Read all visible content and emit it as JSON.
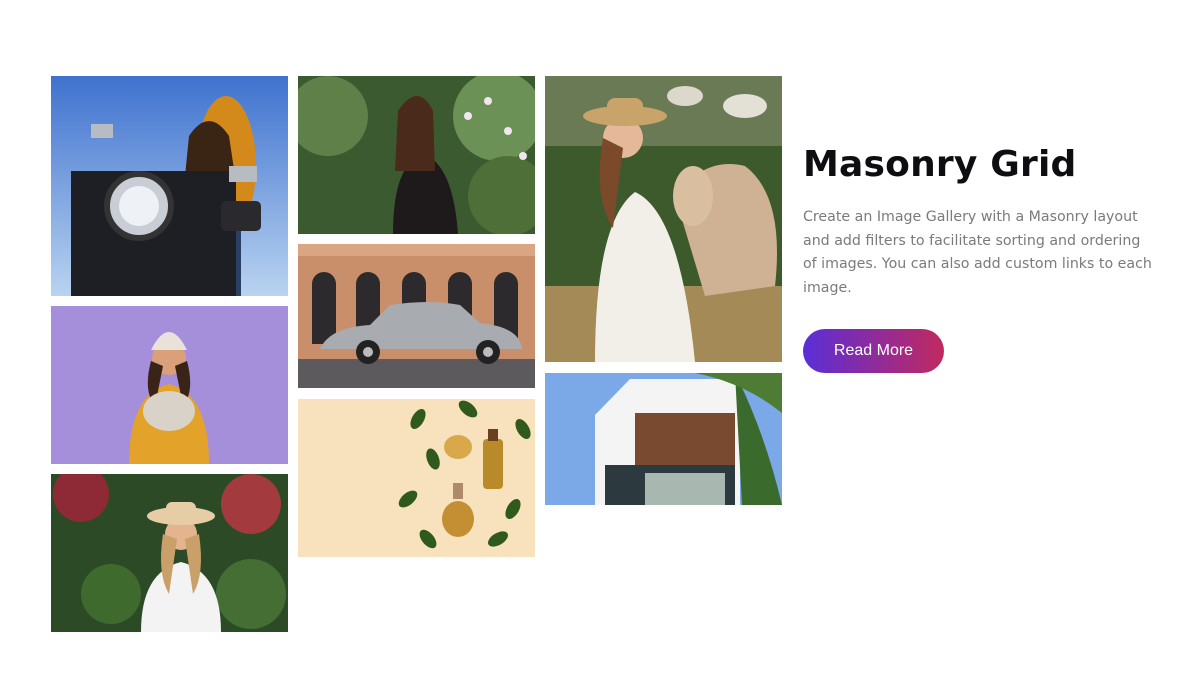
{
  "gallery": {
    "images": [
      {
        "id": "motorcycle-woman",
        "alt": "motorcycle-image"
      },
      {
        "id": "woman-with-dog",
        "alt": "woman-dog-image"
      },
      {
        "id": "woman-in-hat",
        "alt": "woman-hat-image"
      },
      {
        "id": "woman-with-flowers",
        "alt": "woman-flowers-image"
      },
      {
        "id": "vintage-car",
        "alt": "vintage-car-image"
      },
      {
        "id": "oil-bottles",
        "alt": "oil-bottles-image"
      },
      {
        "id": "woman-with-goat",
        "alt": "woman-goat-image"
      },
      {
        "id": "modern-house",
        "alt": "modern-house-image"
      }
    ]
  },
  "info": {
    "title": "Masonry Grid",
    "description": "Create an Image Gallery with a Masonry layout and add filters to facilitate sorting and ordering of images. You can also add custom links to each image.",
    "button_label": "Read More"
  },
  "colors": {
    "title": "#0e0e12",
    "description": "#7a7a7f",
    "button_gradient_start": "#5a2ed8",
    "button_gradient_end": "#c1295f",
    "button_text": "#ffffff"
  }
}
